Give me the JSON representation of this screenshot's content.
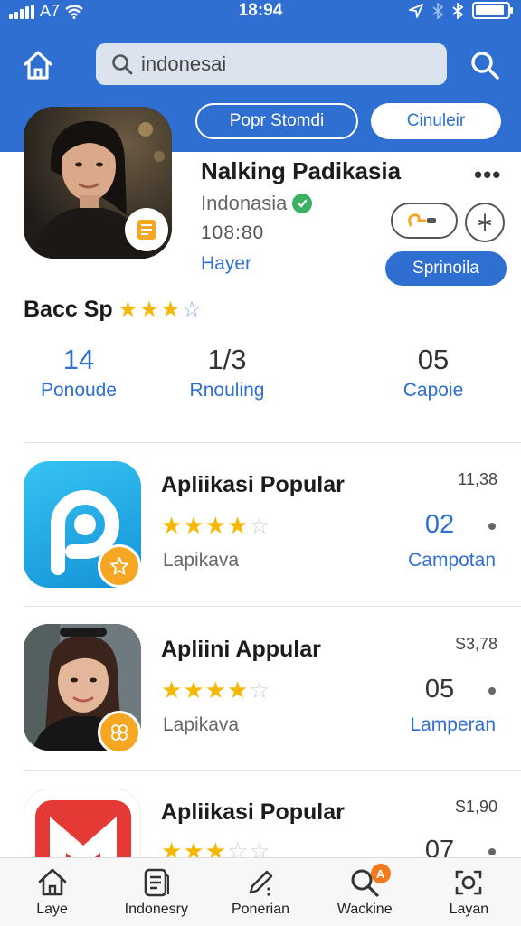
{
  "status": {
    "carrier": "A7",
    "time": "18:94",
    "battery_level": 0.9
  },
  "header": {
    "search": {
      "value": "indonesai",
      "placeholder": ""
    },
    "tabs": [
      {
        "label": "Popr Stomdi"
      },
      {
        "label": "Cinuleir"
      }
    ]
  },
  "profile": {
    "name": "Nalking Padikasia",
    "country": "Indonasia",
    "number": "108:80",
    "link_label": "Hayer",
    "more_label": "•••",
    "follow_label": "Sprinoila",
    "rating_label": "Bacc Sp",
    "rating": 3,
    "rating_max": 4,
    "stats": [
      {
        "value": "14",
        "label": "Ponoude"
      },
      {
        "value": "1/3",
        "label": "Rnouling"
      },
      {
        "value": "05",
        "label": "Capoie"
      }
    ]
  },
  "apps": [
    {
      "title": "Apliikasi Popular",
      "stars": 4,
      "stars_max": 5,
      "subtitle": "Lapikava",
      "price": "11,38",
      "count": "02",
      "action": "Campotan",
      "count_color": "#2e6fd1"
    },
    {
      "title": "Apliini Appular",
      "stars": 4,
      "stars_max": 5,
      "subtitle": "Lapikava",
      "price": "S3,78",
      "count": "05",
      "action": "Lamperan",
      "count_color": "#333333"
    },
    {
      "title": "Apliikasi Popular",
      "stars": 3,
      "stars_max": 5,
      "subtitle": "",
      "price": "S1,90",
      "count": "07",
      "action": "",
      "count_color": "#333333"
    }
  ],
  "nav": [
    {
      "label": "Laye",
      "icon": "home-icon"
    },
    {
      "label": "Indonesry",
      "icon": "document-icon"
    },
    {
      "label": "Ponerian",
      "icon": "pencil-icon"
    },
    {
      "label": "Wackine",
      "icon": "search-icon",
      "badge": "A"
    },
    {
      "label": "Layan",
      "icon": "camera-icon"
    }
  ],
  "colors": {
    "primary": "#2e6fd1",
    "star": "#f5b800",
    "badge": "#f5a623",
    "verified": "#3bb262"
  }
}
